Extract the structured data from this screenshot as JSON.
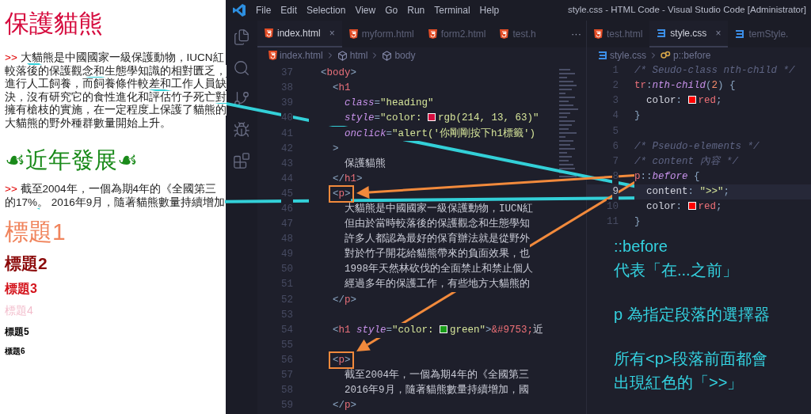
{
  "preview": {
    "title": "保護貓熊",
    "paragraph_1": {
      "marker": ">>",
      "lines": [
        "大貓熊是中國國家一級保護動物，IUCN紅",
        "較落後的保護觀念和生態學知識的相對匱乏，",
        "進行人工飼養，而飼養條件較差和工作人員缺",
        "決，沒有研究它的食性進化和評估竹子死亡對",
        "擁有槍枝的實施，在一定程度上保護了貓熊的",
        "大貓熊的野外種群數量開始上升。"
      ]
    },
    "subtitle": "☙近年發展☙",
    "paragraph_2": {
      "marker": ">>",
      "lines": [
        "截至2004年，一個為期4年的《全國第三",
        "的17%。 2016年9月，隨著貓熊數量持續增加"
      ]
    },
    "headings": [
      {
        "text": "標題1",
        "kind": "h1",
        "color": "#f0845c"
      },
      {
        "text": "標題2",
        "kind": "h2",
        "color": "#8b0a0a"
      },
      {
        "text": "標題3",
        "kind": "h3",
        "color": "#d4141c"
      },
      {
        "text": "標題4",
        "kind": "h4",
        "color": "#f2bccb"
      },
      {
        "text": "標題5",
        "kind": "h5",
        "color": "#000000"
      },
      {
        "text": "標題6",
        "kind": "h6",
        "color": "#000000"
      }
    ]
  },
  "editor": {
    "menu": [
      "File",
      "Edit",
      "Selection",
      "View",
      "Go",
      "Run",
      "Terminal",
      "Help"
    ],
    "window_title": "style.css - HTML Code - Visual Studio Code [Administrator]",
    "left_group": {
      "tabs": [
        {
          "label": "index.html",
          "kind": "html",
          "selected": true,
          "close": "×"
        },
        {
          "label": "myform.html",
          "kind": "html",
          "selected": false
        },
        {
          "label": "form2.html",
          "kind": "html",
          "selected": false
        },
        {
          "label": "test.h",
          "kind": "html",
          "selected": false
        }
      ],
      "overflow": "···",
      "breadcrumbs": [
        {
          "label": "index.html",
          "kind": "html"
        },
        {
          "label": "html",
          "kind": "element"
        },
        {
          "label": "body",
          "kind": "element"
        }
      ],
      "lines": [
        {
          "number": "37",
          "segments": [
            {
              "t": "  <",
              "kind": "punct"
            },
            {
              "t": "body",
              "kind": "tag"
            },
            {
              "t": ">",
              "kind": "punct"
            }
          ]
        },
        {
          "number": "38",
          "segments": [
            {
              "t": "    <",
              "kind": "punct"
            },
            {
              "t": "h1",
              "kind": "tag"
            }
          ]
        },
        {
          "number": "39",
          "segments": [
            {
              "t": "      class",
              "kind": "attr"
            },
            {
              "t": "=",
              "kind": "punct"
            },
            {
              "t": "\"heading\"",
              "kind": "str"
            }
          ]
        },
        {
          "number": "40",
          "segments": [
            {
              "t": "      style",
              "kind": "attr"
            },
            {
              "t": "=",
              "kind": "punct"
            },
            {
              "t": "\"color: ",
              "kind": "str"
            },
            {
              "kind": "swatch",
              "color": "#d60d3f"
            },
            {
              "t": "rgb(214, 13, 63)\"",
              "kind": "str"
            }
          ]
        },
        {
          "number": "41",
          "segments": [
            {
              "t": "      onclick",
              "kind": "attr"
            },
            {
              "t": "=",
              "kind": "punct"
            },
            {
              "t": "\"alert('你剛剛按下h1標籤')",
              "kind": "str"
            }
          ]
        },
        {
          "number": "42",
          "segments": [
            {
              "t": "    >",
              "kind": "punct"
            }
          ]
        },
        {
          "number": "43",
          "segments": [
            {
              "t": "      保護貓熊",
              "kind": "text"
            }
          ]
        },
        {
          "number": "44",
          "segments": [
            {
              "t": "    </",
              "kind": "punct"
            },
            {
              "t": "h1",
              "kind": "tag"
            },
            {
              "t": ">",
              "kind": "punct"
            }
          ]
        },
        {
          "number": "45",
          "segments": [
            {
              "t": "    <",
              "kind": "punct"
            },
            {
              "t": "p",
              "kind": "tag"
            },
            {
              "t": ">",
              "kind": "punct"
            }
          ]
        },
        {
          "number": "46",
          "segments": [
            {
              "t": "      大貓熊是中國國家一級保護動物，IUCN紅",
              "kind": "text"
            }
          ]
        },
        {
          "number": "47",
          "segments": [
            {
              "t": "      但由於當時較落後的保護觀念和生態學知",
              "kind": "text"
            }
          ]
        },
        {
          "number": "48",
          "segments": [
            {
              "t": "      許多人都認為最好的保育辦法就是從野外",
              "kind": "text"
            }
          ]
        },
        {
          "number": "49",
          "segments": [
            {
              "t": "      對於竹子開花給貓熊帶來的負面效果，也",
              "kind": "text"
            }
          ]
        },
        {
          "number": "50",
          "segments": [
            {
              "t": "      1998年天然林砍伐的全面禁止和禁止個人",
              "kind": "text"
            }
          ]
        },
        {
          "number": "51",
          "segments": [
            {
              "t": "      經過多年的保護工作，有些地方大貓熊的",
              "kind": "text"
            }
          ]
        },
        {
          "number": "52",
          "segments": [
            {
              "t": "    </",
              "kind": "punct"
            },
            {
              "t": "p",
              "kind": "tag"
            },
            {
              "t": ">",
              "kind": "punct"
            }
          ]
        },
        {
          "number": "53"
        },
        {
          "number": "54",
          "segments": [
            {
              "t": "    <",
              "kind": "punct"
            },
            {
              "t": "h1",
              "kind": "tag"
            },
            {
              "t": " style",
              "kind": "attr"
            },
            {
              "t": "=",
              "kind": "punct"
            },
            {
              "t": "\"color: ",
              "kind": "str"
            },
            {
              "kind": "swatch",
              "color": "#1a9c1a"
            },
            {
              "t": "green\"",
              "kind": "str"
            },
            {
              "t": ">",
              "kind": "punct"
            },
            {
              "t": "&#9753;",
              "kind": "entity"
            },
            {
              "t": "近",
              "kind": "text"
            }
          ]
        },
        {
          "number": "55"
        },
        {
          "number": "56",
          "segments": [
            {
              "t": "    <",
              "kind": "punct"
            },
            {
              "t": "p",
              "kind": "tag"
            },
            {
              "t": ">",
              "kind": "punct"
            }
          ]
        },
        {
          "number": "57",
          "segments": [
            {
              "t": "      截至2004年，一個為期4年的《全國第三",
              "kind": "text"
            }
          ]
        },
        {
          "number": "58",
          "segments": [
            {
              "t": "      2016年9月，隨著貓熊數量持續增加，國",
              "kind": "text"
            }
          ]
        },
        {
          "number": "59",
          "segments": [
            {
              "t": "    </",
              "kind": "punct"
            },
            {
              "t": "p",
              "kind": "tag"
            },
            {
              "t": ">",
              "kind": "punct"
            }
          ]
        }
      ]
    },
    "right_group": {
      "tabs": [
        {
          "label": "test.html",
          "kind": "html",
          "selected": false
        },
        {
          "label": "style.css",
          "kind": "css",
          "selected": true,
          "close": "×"
        },
        {
          "label": "temStyle.",
          "kind": "css",
          "selected": false
        }
      ],
      "breadcrumbs": [
        {
          "label": "style.css",
          "kind": "css"
        },
        {
          "label": "p::before",
          "kind": "rule"
        }
      ],
      "lines": [
        {
          "number": "1",
          "current": false,
          "segments": [
            {
              "t": "/* Seudo-class nth-child */",
              "kind": "comment"
            }
          ]
        },
        {
          "number": "2",
          "current": false,
          "segments": [
            {
              "t": "tr",
              "kind": "sel"
            },
            {
              "t": ":",
              "kind": "punct"
            },
            {
              "t": "nth-child",
              "kind": "pseudo"
            },
            {
              "t": "(",
              "kind": "punct"
            },
            {
              "t": "2",
              "kind": "num"
            },
            {
              "t": ") {",
              "kind": "punct"
            }
          ]
        },
        {
          "number": "3",
          "current": false,
          "segments": [
            {
              "t": "  color",
              "kind": "prop"
            },
            {
              "t": ": ",
              "kind": "punct"
            },
            {
              "kind": "swatch",
              "color": "#ff0000"
            },
            {
              "t": "red",
              "kind": "val"
            },
            {
              "t": ";",
              "kind": "punct"
            }
          ]
        },
        {
          "number": "4",
          "current": false,
          "segments": [
            {
              "t": "}",
              "kind": "punct"
            }
          ]
        },
        {
          "number": "5",
          "current": false
        },
        {
          "number": "6",
          "current": false,
          "segments": [
            {
              "t": "/* Pseudo-elements */",
              "kind": "comment"
            }
          ]
        },
        {
          "number": "7",
          "current": false,
          "segments": [
            {
              "t": "/* content 內容 */",
              "kind": "comment"
            }
          ]
        },
        {
          "number": "8",
          "current": false,
          "segments": [
            {
              "t": "p",
              "kind": "sel"
            },
            {
              "t": "::",
              "kind": "punct"
            },
            {
              "t": "before",
              "kind": "pseudo"
            },
            {
              "t": " {",
              "kind": "punct"
            }
          ]
        },
        {
          "number": "9",
          "current": true,
          "segments": [
            {
              "t": "  content",
              "kind": "prop"
            },
            {
              "t": ": ",
              "kind": "punct"
            },
            {
              "t": "\">>\"",
              "kind": "str"
            },
            {
              "t": ";",
              "kind": "punct"
            }
          ]
        },
        {
          "number": "10",
          "current": false,
          "segments": [
            {
              "t": "  color",
              "kind": "prop"
            },
            {
              "t": ": ",
              "kind": "punct"
            },
            {
              "kind": "swatch",
              "color": "#ff0000"
            },
            {
              "t": "red",
              "kind": "val"
            },
            {
              "t": ";",
              "kind": "punct"
            }
          ]
        },
        {
          "number": "11",
          "current": false,
          "segments": [
            {
              "t": "}",
              "kind": "punct"
            }
          ]
        }
      ]
    }
  },
  "annotation": {
    "paragraphs": [
      [
        "::before",
        "代表「在...之前」"
      ],
      [
        "p 為指定段落的選擇器"
      ],
      [
        "所有<p>段落前面都會",
        "出現紅色的「>>」"
      ]
    ]
  }
}
